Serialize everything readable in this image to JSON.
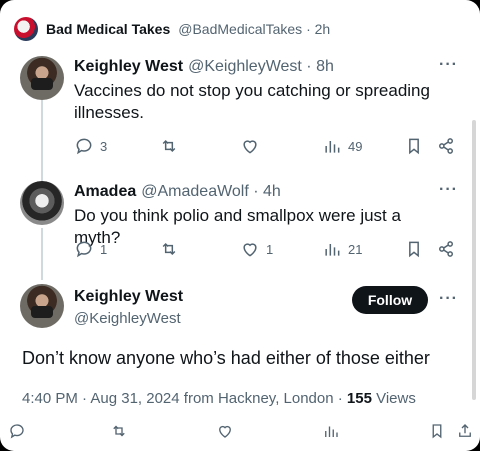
{
  "outer": {
    "name": "Bad Medical Takes",
    "handle": "@BadMedicalTakes · 2h"
  },
  "reply1": {
    "name": "Keighley West",
    "meta": "@KeighleyWest · 8h",
    "text": "Vaccines do not stop you catching or spreading illnesses.",
    "more": "···",
    "replies": "3",
    "views": "49"
  },
  "reply2": {
    "name": "Amadea",
    "meta": "@AmadeaWolf · 4h",
    "text": "Do you think polio and smallpox were just a myth?",
    "more": "···",
    "replies": "1",
    "likes": "1",
    "views": "21"
  },
  "main": {
    "name": "Keighley West",
    "handle": "@KeighleyWest",
    "follow_label": "Follow",
    "more": "···",
    "text": "Don’t know anyone who’s had either of those either",
    "meta_prefix": "4:40 PM · Aug 31, 2024 from Hackney, London · ",
    "views_count": "155",
    "views_label": " Views"
  },
  "icons": [
    "reply-icon",
    "retweet-icon",
    "like-icon",
    "views-icon",
    "bookmark-icon",
    "share-icon"
  ]
}
